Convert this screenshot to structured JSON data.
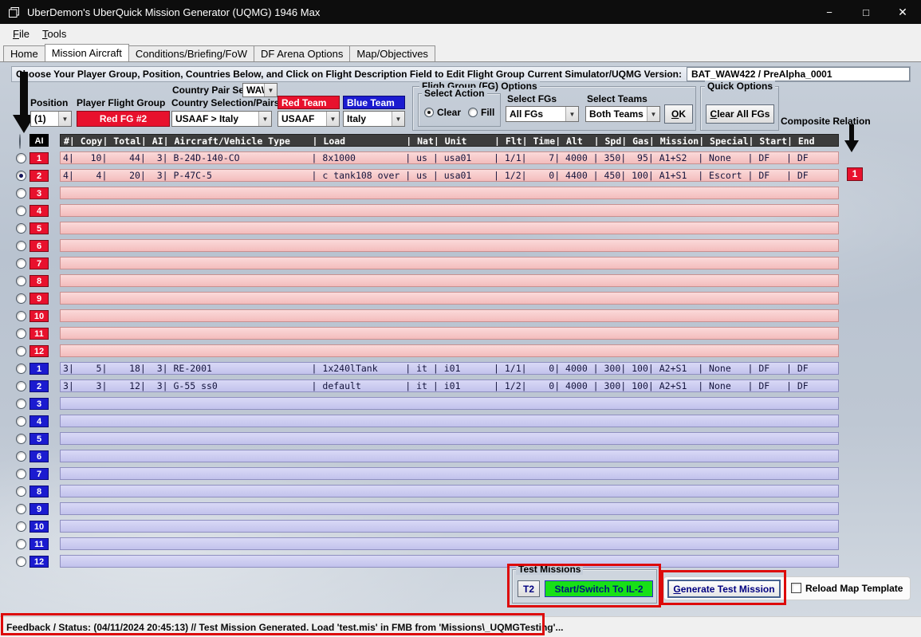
{
  "window": {
    "title": "UberDemon's UberQuick Mission Generator (UQMG) 1946 Max",
    "minimize": "−",
    "maximize": "□",
    "close": "✕"
  },
  "menu": {
    "file": "File",
    "tools": "Tools"
  },
  "tabs": {
    "home": "Home",
    "mission_aircraft": "Mission Aircraft",
    "conditions": "Conditions/Briefing/FoW",
    "df_arena": "DF Arena Options",
    "map_objectives": "Map/Objectives"
  },
  "header": {
    "instruction": "Choose Your Player Group, Position, Countries Below, and Click on Flight Description Field to Edit Flight Group",
    "version_label": "Current Simulator/UQMG Version:",
    "version_value": "BAT_WAW422 / PreAlpha_0001"
  },
  "controls": {
    "country_pair_set": {
      "label": "Country Pair Set",
      "value": "WAW"
    },
    "position": {
      "label": "Position",
      "value": "(1)"
    },
    "player_flight_group": {
      "label": "Player Flight Group",
      "value": "Red FG #2"
    },
    "country_selection": {
      "label": "Country Selection/Pairs",
      "value": "USAAF > Italy"
    },
    "red_team": {
      "label": "Red Team",
      "value": "USAAF",
      "color": "#e8112d"
    },
    "blue_team": {
      "label": "Blue Team",
      "value": "Italy",
      "color": "#1b1bd0"
    },
    "fg_options": {
      "title": "Fligh Group (FG) Options",
      "select_action": {
        "title": "Select Action",
        "clear": "Clear",
        "fill": "Fill",
        "selected": "Clear"
      },
      "select_fgs": {
        "label": "Select FGs",
        "value": "All FGs"
      },
      "select_teams": {
        "label": "Select Teams",
        "value": "Both Teams"
      },
      "ok": "OK"
    },
    "quick_options": {
      "title": "Quick Options",
      "clear_all": "Clear All FGs"
    },
    "composite_relation": "Composite Relation"
  },
  "table": {
    "ai_label": "AI",
    "header": "#| Copy| Total| AI| Aircraft/Vehicle Type    | Load           | Nat| Unit     | Flt| Time| Alt  | Spd| Gas| Mission| Special| Start| End",
    "composite_badge": "1",
    "red_rows": [
      {
        "num": "1",
        "selected": false,
        "text": "4|   10|    44|  3| B-24D-140-CO             | 8x1000         | us | usa01    | 1/1|    7| 4000 | 350|  95| A1+S2  | None   | DF   | DF"
      },
      {
        "num": "2",
        "selected": true,
        "text": "4|    4|    20|  3| P-47C-5                  | c tank108 over | us | usa01    | 1/2|    0| 4400 | 450| 100| A1+S1  | Escort | DF   | DF"
      },
      {
        "num": "3",
        "selected": false,
        "text": ""
      },
      {
        "num": "4",
        "selected": false,
        "text": ""
      },
      {
        "num": "5",
        "selected": false,
        "text": ""
      },
      {
        "num": "6",
        "selected": false,
        "text": ""
      },
      {
        "num": "7",
        "selected": false,
        "text": ""
      },
      {
        "num": "8",
        "selected": false,
        "text": ""
      },
      {
        "num": "9",
        "selected": false,
        "text": ""
      },
      {
        "num": "10",
        "selected": false,
        "text": ""
      },
      {
        "num": "11",
        "selected": false,
        "text": ""
      },
      {
        "num": "12",
        "selected": false,
        "text": ""
      }
    ],
    "blue_rows": [
      {
        "num": "1",
        "selected": false,
        "text": "3|    5|    18|  3| RE-2001                  | 1x240lTank     | it | i01      | 1/1|    0| 4000 | 300| 100| A2+S1  | None   | DF   | DF"
      },
      {
        "num": "2",
        "selected": false,
        "text": "3|    3|    12|  3| G-55 ss0                 | default        | it | i01      | 1/2|    0| 4000 | 300| 100| A2+S1  | None   | DF   | DF"
      },
      {
        "num": "3",
        "selected": false,
        "text": ""
      },
      {
        "num": "4",
        "selected": false,
        "text": ""
      },
      {
        "num": "5",
        "selected": false,
        "text": ""
      },
      {
        "num": "6",
        "selected": false,
        "text": ""
      },
      {
        "num": "7",
        "selected": false,
        "text": ""
      },
      {
        "num": "8",
        "selected": false,
        "text": ""
      },
      {
        "num": "9",
        "selected": false,
        "text": ""
      },
      {
        "num": "10",
        "selected": false,
        "text": ""
      },
      {
        "num": "11",
        "selected": false,
        "text": ""
      },
      {
        "num": "12",
        "selected": false,
        "text": ""
      }
    ]
  },
  "test_missions": {
    "title": "Test Missions",
    "t2": "T2",
    "start_switch": "Start/Switch To IL-2",
    "generate": "Generate Test Mission",
    "reload_map": "Reload Map Template"
  },
  "status": {
    "text": "Feedback / Status:  (04/11/2024 20:45:13) // Test Mission Generated.  Load 'test.mis' in FMB from 'Missions\\_UQMGTesting'..."
  }
}
